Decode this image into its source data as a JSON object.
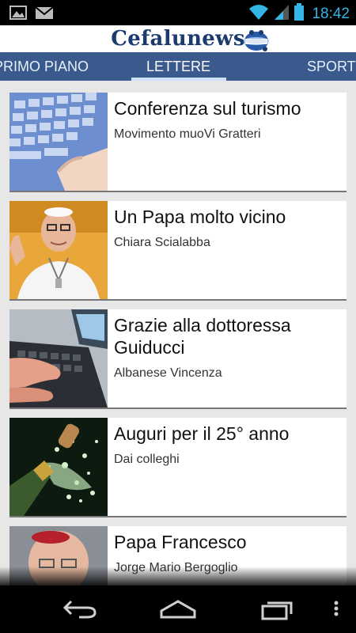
{
  "status_bar": {
    "time": "18:42",
    "icons": [
      "image-notification-icon",
      "gmail-icon",
      "wifi-icon",
      "signal-icon",
      "battery-icon"
    ]
  },
  "header": {
    "brand_part1": "Cefalu",
    "brand_part2": "news",
    "brand_color": "#1b3a6e"
  },
  "tabs": {
    "items": [
      {
        "label": "PRIMO PIANO",
        "active": false
      },
      {
        "label": "LETTERE",
        "active": true
      },
      {
        "label": "SPORT",
        "active": false
      }
    ],
    "bar_color": "#3a5a8e"
  },
  "articles": [
    {
      "title": "Conferenza sul turismo",
      "author": "Movimento muoVi Gratteri",
      "thumb": "keyboard-hand-image"
    },
    {
      "title": "Un Papa molto vicino",
      "author": "Chiara Scialabba",
      "thumb": "pope-portrait-image"
    },
    {
      "title": "Grazie alla dottoressa Guiducci",
      "author": "Albanese Vincenza",
      "thumb": "laptop-typing-image"
    },
    {
      "title": "Auguri per il 25° anno",
      "author": "Dai colleghi",
      "thumb": "champagne-cork-image"
    },
    {
      "title": "Papa Francesco",
      "author": "Jorge Mario Bergoglio",
      "thumb": "pope-francesco-image"
    }
  ],
  "nav": {
    "icons": [
      "back-icon",
      "home-icon",
      "recent-apps-icon",
      "overflow-menu-icon"
    ]
  }
}
